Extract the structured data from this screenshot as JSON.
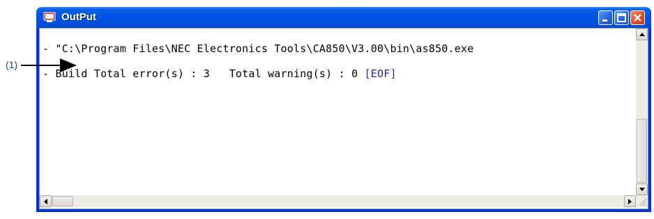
{
  "window": {
    "title": "OutPut",
    "controls": {
      "minimize": "minimize-icon",
      "maximize": "maximize-icon",
      "close": "close-icon"
    }
  },
  "output": {
    "lines": [
      "- \"C:\\Program Files\\NEC Electronics Tools\\CA850\\V3.00\\bin\\as850.exe",
      "- Build Total error(s) : 3   Total warning(s) : 0 "
    ],
    "eof_marker": "[EOF]"
  },
  "annotation": {
    "label": "(1)"
  },
  "colors": {
    "titlebar": "#0054e3",
    "eof_text": "#1c2ba8",
    "callout": "#1a3f9e",
    "close_button": "#e05028"
  }
}
